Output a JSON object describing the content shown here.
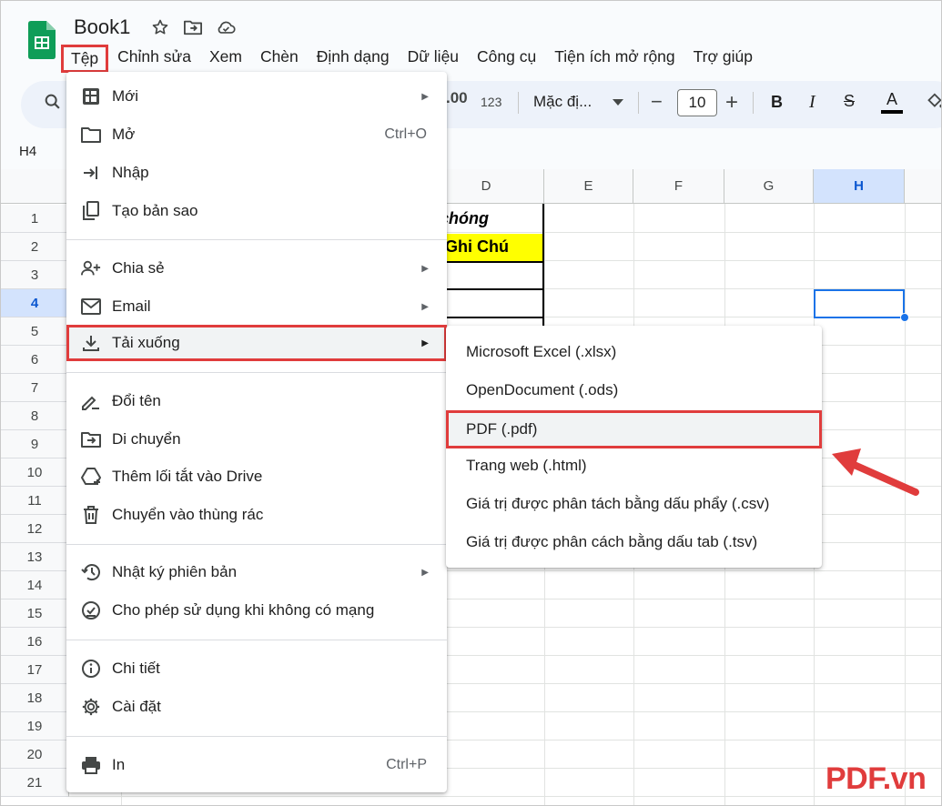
{
  "app": {
    "doc_title": "Book1",
    "name_box": "H4",
    "brand_color": "#0f9d58",
    "highlight_color": "#e03c3c"
  },
  "menubar": [
    "Tệp",
    "Chỉnh sửa",
    "Xem",
    "Chèn",
    "Định dạng",
    "Dữ liệu",
    "Công cụ",
    "Tiện ích mở rộng",
    "Trợ giúp"
  ],
  "toolbar": {
    "number_format": "123",
    "font_name": "Mặc đị...",
    "font_size": "10",
    "minus": "−",
    "plus": "+",
    "bold": "B",
    "italic": "I",
    "strike": "S",
    "text_color": "A"
  },
  "columns": [
    "D",
    "E",
    "F",
    "G",
    "H"
  ],
  "rows": [
    "1",
    "2",
    "3",
    "4",
    "5",
    "6",
    "7",
    "8",
    "9",
    "10",
    "11",
    "12",
    "13",
    "14",
    "15",
    "16",
    "17",
    "18",
    "19",
    "20",
    "21"
  ],
  "cells": {
    "D1": "chóng",
    "D2": "Ghi Chú"
  },
  "file_menu": {
    "items": [
      {
        "label": "Mới",
        "icon": "new-sheet-icon",
        "shortcut": "",
        "submenu": true
      },
      {
        "label": "Mở",
        "icon": "folder-icon",
        "shortcut": "Ctrl+O",
        "submenu": false
      },
      {
        "label": "Nhập",
        "icon": "import-icon",
        "shortcut": "",
        "submenu": false
      },
      {
        "label": "Tạo bản sao",
        "icon": "copy-icon",
        "shortcut": "",
        "submenu": false
      },
      {
        "label": "Chia sẻ",
        "icon": "share-person-icon",
        "shortcut": "",
        "submenu": true
      },
      {
        "label": "Email",
        "icon": "email-icon",
        "shortcut": "",
        "submenu": true
      },
      {
        "label": "Tải xuống",
        "icon": "download-icon",
        "shortcut": "",
        "submenu": true
      },
      {
        "label": "Đổi tên",
        "icon": "rename-icon",
        "shortcut": "",
        "submenu": false
      },
      {
        "label": "Di chuyển",
        "icon": "move-folder-icon",
        "shortcut": "",
        "submenu": false
      },
      {
        "label": "Thêm lối tắt vào Drive",
        "icon": "drive-shortcut-icon",
        "shortcut": "",
        "submenu": false
      },
      {
        "label": "Chuyển vào thùng rác",
        "icon": "trash-icon",
        "shortcut": "",
        "submenu": false
      },
      {
        "label": "Nhật ký phiên bản",
        "icon": "history-icon",
        "shortcut": "",
        "submenu": true
      },
      {
        "label": "Cho phép sử dụng khi không có mạng",
        "icon": "offline-icon",
        "shortcut": "",
        "submenu": false
      },
      {
        "label": "Chi tiết",
        "icon": "info-icon",
        "shortcut": "",
        "submenu": false
      },
      {
        "label": "Cài đặt",
        "icon": "gear-icon",
        "shortcut": "",
        "submenu": false
      },
      {
        "label": "In",
        "icon": "printer-icon",
        "shortcut": "Ctrl+P",
        "submenu": false
      }
    ]
  },
  "download_submenu": [
    "Microsoft Excel (.xlsx)",
    "OpenDocument (.ods)",
    "PDF (.pdf)",
    "Trang web (.html)",
    "Giá trị được phân tách bằng dấu phẩy (.csv)",
    "Giá trị được phân cách bằng dấu tab (.tsv)"
  ],
  "watermark": "PDF.vn"
}
